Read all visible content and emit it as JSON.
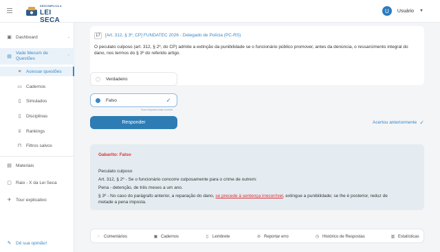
{
  "header": {
    "logo_small": "DESCOMPLICA A",
    "logo_big": "LEI SECA",
    "user_initial": "U",
    "user_name": "Usuário"
  },
  "sidebar": {
    "dashboard": "Dashboard",
    "vade_line1": "Vade Mecum de",
    "vade_line2": "Questões",
    "sub_items": [
      "Acessar questões",
      "Cadernos",
      "Simulados",
      "Disciplinas",
      "Rankings",
      "Filtros salvos"
    ],
    "materiais": "Materiais",
    "raio_x": "Raio - X da Lei Seca",
    "tour": "Tour explicativo",
    "feedback": "Dê sua opinião!"
  },
  "question": {
    "number": "17",
    "reference": "[Art. 312, § 3º, CP] FUNDATEC 2026 - Delegado de Polícia (PC-RS)",
    "text": "O peculato culposo (art. 312, § 2º, do CP) admite a extinção da punibilidade se o funcionário público promover, antes da denúncia, o ressarcimento integral do dano, nos termos do § 3º do referido artigo."
  },
  "options": {
    "true_label": "Verdadeiro",
    "false_label": "Falso",
    "hint": "Sua resposta está correta"
  },
  "actions": {
    "submit": "Responder",
    "previously_correct": "Acertou anteriormente"
  },
  "answer": {
    "title": "Gabarito: Falso",
    "heading": "Peculato culposo",
    "line1": "Art. 312, § 2º - Se o funcionário concorre culposamente para o crime de outrem:",
    "line2": "Pena - detenção, de três meses a um ano.",
    "line3_pre": "§ 3º - No caso do parágrafo anterior, a reparação do dano,",
    "line3_hl": "se precede à sentença irrecorrível",
    "line3_post": ", extingue a punibilidade; se lhe é posterior, reduz de",
    "line4": "metade a pena imposta."
  },
  "bottom_bar": {
    "comentarios": "Comentários",
    "cadernos": "Cadernos",
    "lembrete": "Lembrete",
    "reportar": "Reportar erro",
    "historico": "Histórico de Respostas",
    "estatisticas": "Estatísticas"
  },
  "colors": {
    "accent": "#3a86c4",
    "primary_button": "#2d7cb3",
    "gabarito_red": "#d93030"
  }
}
